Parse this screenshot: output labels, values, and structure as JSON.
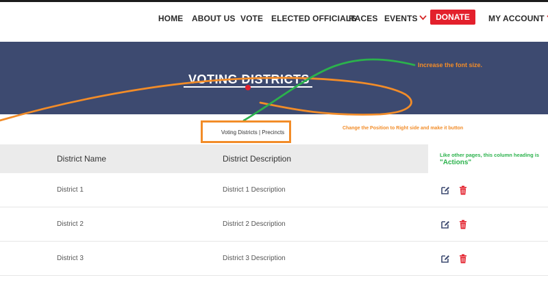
{
  "nav": {
    "items": [
      {
        "label": "HOME"
      },
      {
        "label": "ABOUT US"
      },
      {
        "label": "VOTE"
      },
      {
        "label": "ELECTED OFFICIALS"
      },
      {
        "label": "RACES"
      },
      {
        "label": "EVENTS"
      }
    ],
    "donate_label": "DONATE",
    "account_label": "MY ACCOUNT"
  },
  "banner": {
    "title": "VOTING DISTRICTS"
  },
  "subnav": {
    "districts_label": "Voting Districts",
    "separator": " | ",
    "precincts_label": "Precincts"
  },
  "table": {
    "headers": [
      "District Name",
      "District Description"
    ],
    "rows": [
      {
        "name": "District 1",
        "description": "District 1 Description"
      },
      {
        "name": "District 2",
        "description": "District 2 Description"
      },
      {
        "name": "District 3",
        "description": "District 3 Description"
      }
    ],
    "row_icons": [
      "edit-icon",
      "delete-icon"
    ]
  },
  "annotations": {
    "font_size_note": "Increase the font size.",
    "position_note": "Change the Position to Right side and make it button",
    "actions_note_line1": "Like other pages, this column heading is",
    "actions_note_line2": "\"Actions\""
  },
  "colors": {
    "banner_bg": "#3d4a70",
    "donate_bg": "#e3202c",
    "edit_icon": "#3d4a70",
    "delete_icon": "#e3202c",
    "annotation_orange": "#f28c28",
    "annotation_green": "#2bb24c"
  }
}
